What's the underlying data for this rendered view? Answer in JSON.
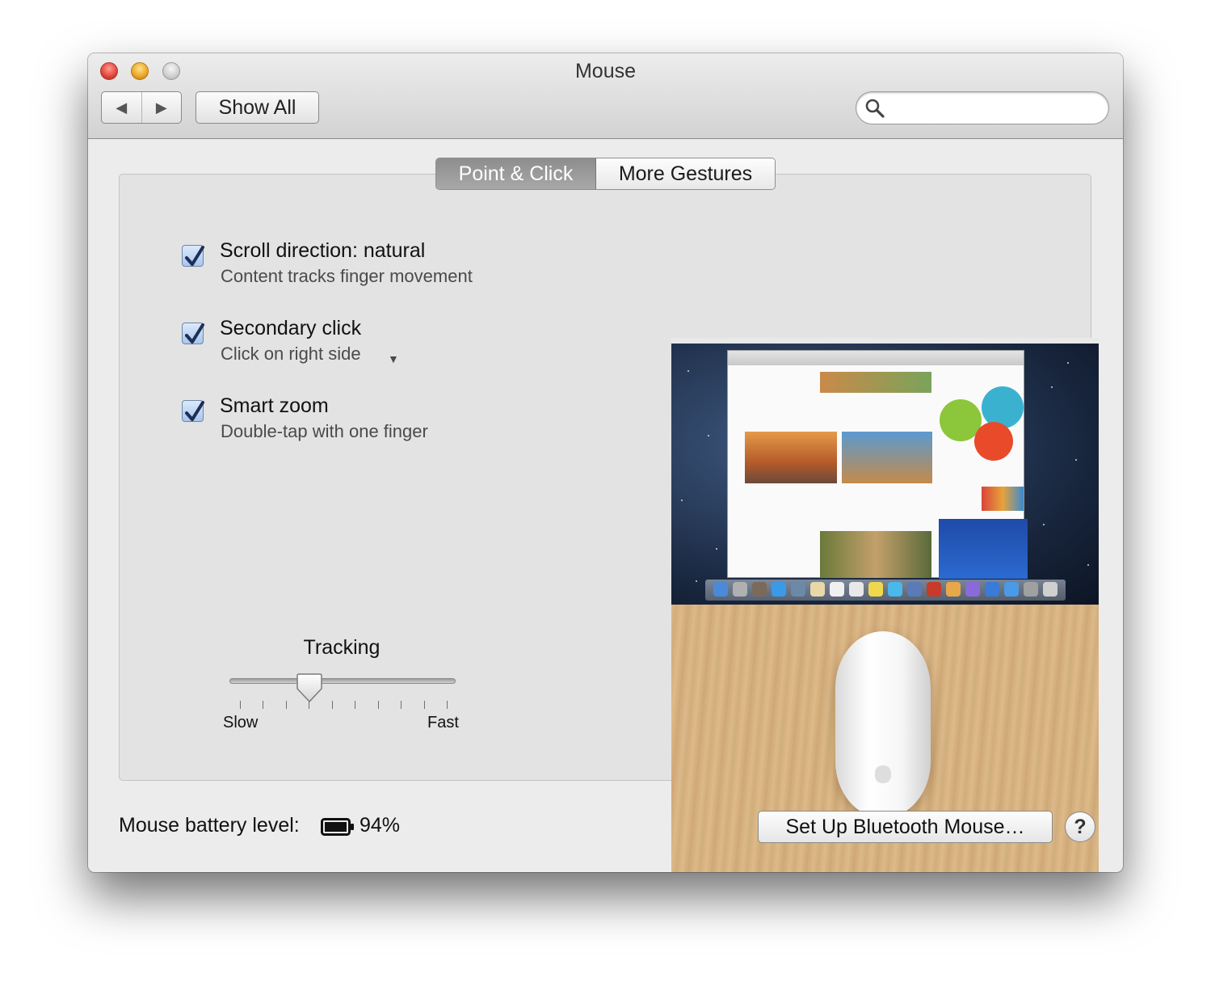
{
  "window": {
    "title": "Mouse"
  },
  "toolbar": {
    "back_icon": "◀",
    "forward_icon": "▶",
    "show_all_label": "Show All",
    "search_placeholder": ""
  },
  "tabs": [
    {
      "label": "Point & Click",
      "selected": true
    },
    {
      "label": "More Gestures",
      "selected": false
    }
  ],
  "options": [
    {
      "title": "Scroll direction: natural",
      "subtitle": "Content tracks finger movement",
      "checked": true
    },
    {
      "title": "Secondary click",
      "subtitle": "Click on right side",
      "checked": true,
      "has_dropdown": true
    },
    {
      "title": "Smart zoom",
      "subtitle": "Double-tap with one finger",
      "checked": true
    }
  ],
  "tracking": {
    "label": "Tracking",
    "min_label": "Slow",
    "max_label": "Fast",
    "tick_count": 10,
    "level_fraction": 0.33
  },
  "footer": {
    "battery_label": "Mouse battery level:",
    "battery_value": "94%",
    "setup_button_label": "Set Up Bluetooth Mouse…",
    "help_label": "?"
  },
  "colors": {
    "checkbox_accent": "#2f5fb0",
    "tab_selected": "#9a9a9a",
    "window_background": "#ececec"
  }
}
